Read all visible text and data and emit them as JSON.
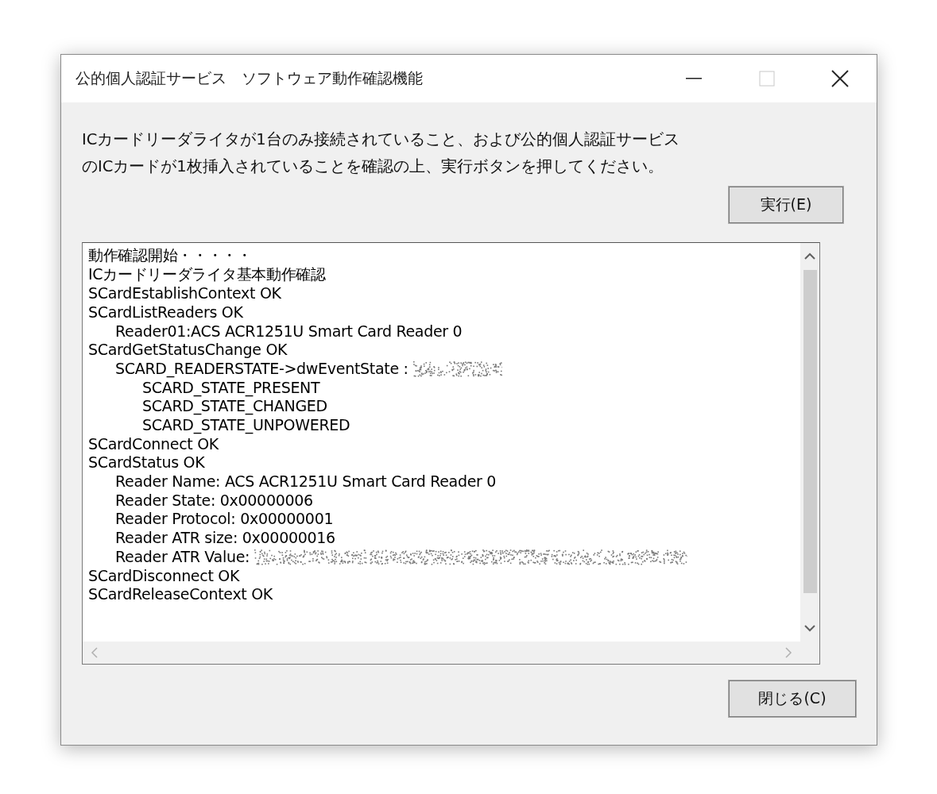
{
  "window": {
    "title": "公的個人認証サービス　ソフトウェア動作確認機能",
    "maximize_disabled": true
  },
  "instruction": [
    "ICカードリーダライタが1台のみ接続されていること、および公的個人認証サービス",
    "のICカードが1枚挿入されていることを確認の上、実行ボタンを押してください。"
  ],
  "run_button": "実行(E)",
  "log": [
    {
      "text": "動作確認開始・・・・・"
    },
    {
      "text": "ICカードリーダライタ基本動作確認"
    },
    {
      "text": "SCardEstablishContext OK"
    },
    {
      "text": "SCardListReaders OK",
      "children": [
        {
          "text": "Reader01:ACS ACR1251U Smart Card Reader 0"
        }
      ]
    },
    {
      "text": "SCardGetStatusChange OK",
      "children": [
        {
          "text": "SCARD_READERSTATE->dwEventState :",
          "redacted": true,
          "children": [
            {
              "text": "SCARD_STATE_PRESENT"
            },
            {
              "text": "SCARD_STATE_CHANGED"
            },
            {
              "text": "SCARD_STATE_UNPOWERED"
            }
          ]
        }
      ]
    },
    {
      "text": "SCardConnect OK"
    },
    {
      "text": "SCardStatus OK",
      "children": [
        {
          "text": "Reader Name: ACS ACR1251U Smart Card Reader 0"
        },
        {
          "text": "Reader State: 0x00000006"
        },
        {
          "text": "Reader Protocol: 0x00000001"
        },
        {
          "text": "Reader ATR size: 0x00000016"
        },
        {
          "text": "Reader ATR Value:",
          "redacted": true,
          "long": true
        }
      ]
    },
    {
      "text": "SCardDisconnect OK"
    },
    {
      "text": "SCardReleaseContext OK"
    }
  ],
  "close_button": "閉じる(C)"
}
